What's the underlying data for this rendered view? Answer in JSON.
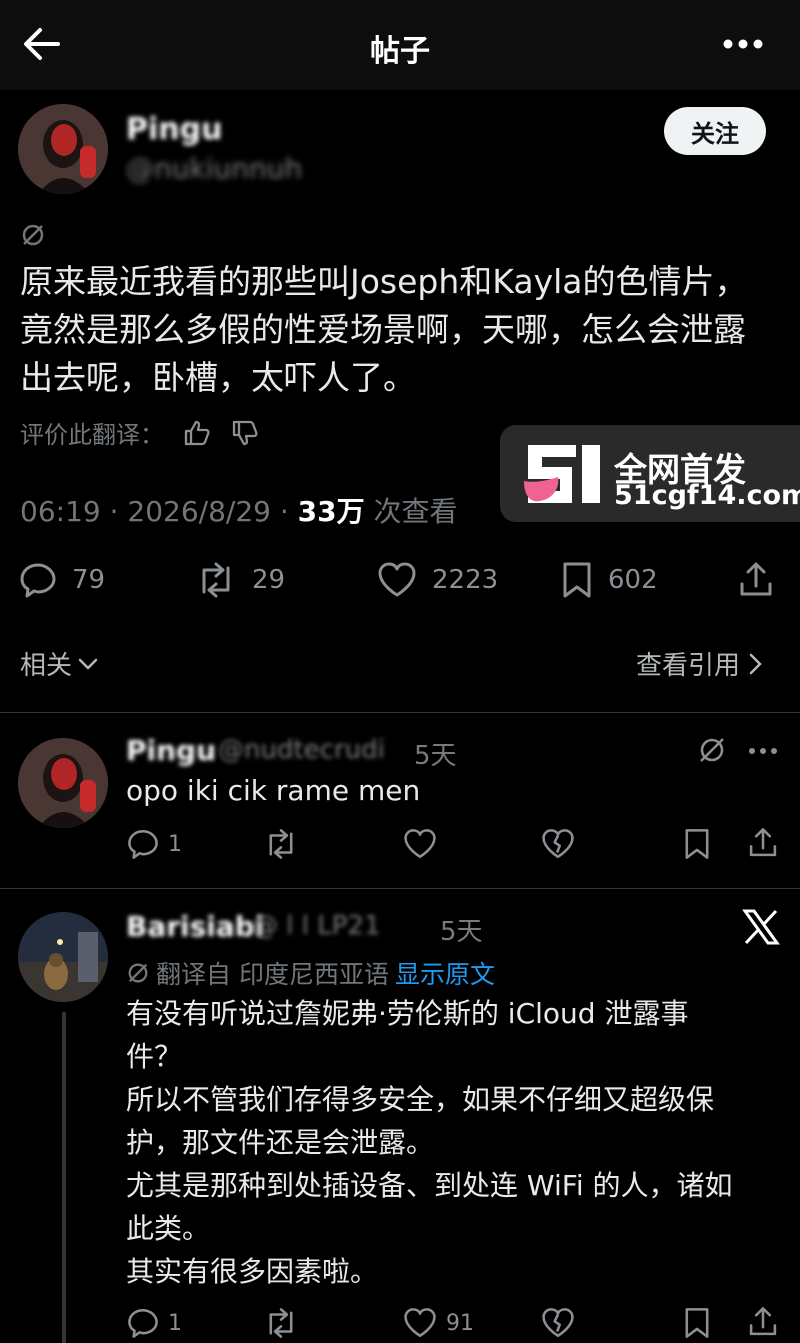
{
  "header": {
    "title": "帖子"
  },
  "post": {
    "author_name": "Pingu",
    "author_handle": "@nukiunnuh",
    "follow_label": "关注",
    "text_lines": [
      "原来最近我看的那些叫Joseph和Kayla的色情片，",
      "竟然是那么多假的性爱场景啊，天哪，怎么会泄露",
      "出去呢，卧槽，太吓人了。"
    ],
    "rate_label": "评价此翻译：",
    "time": "06:19 · 2026/8/29 · ",
    "views_count": "33万",
    "views_label": " 次查看",
    "stats": {
      "replies": "79",
      "reposts": "29",
      "likes": "2223",
      "bookmarks": "602"
    },
    "related_label": "相关",
    "view_quotes_label": "查看引用"
  },
  "watermark": {
    "line1": "全网首发",
    "line2": "51cgf14.com"
  },
  "replies": [
    {
      "name": "Pingu",
      "handle": "@nudtecrudi",
      "time": "5天",
      "text": "opo iki cik rame men",
      "replies": "1"
    },
    {
      "name": "Barisiabi",
      "handle": "@ l l LP21",
      "time": "5天",
      "translate_label": "翻译自 印度尼西亚语",
      "show_original": "显示原文",
      "text_lines": [
        "有没有听说过詹妮弗·劳伦斯的 iCloud 泄露事",
        "件？",
        "所以不管我们存得多安全，如果不仔细又超级保",
        "护，那文件还是会泄露。",
        "尤其是那种到处插设备、到处连 WiFi 的人，诸如",
        "此类。",
        "其实有很多因素啦。"
      ],
      "replies": "1",
      "likes": "91"
    }
  ]
}
